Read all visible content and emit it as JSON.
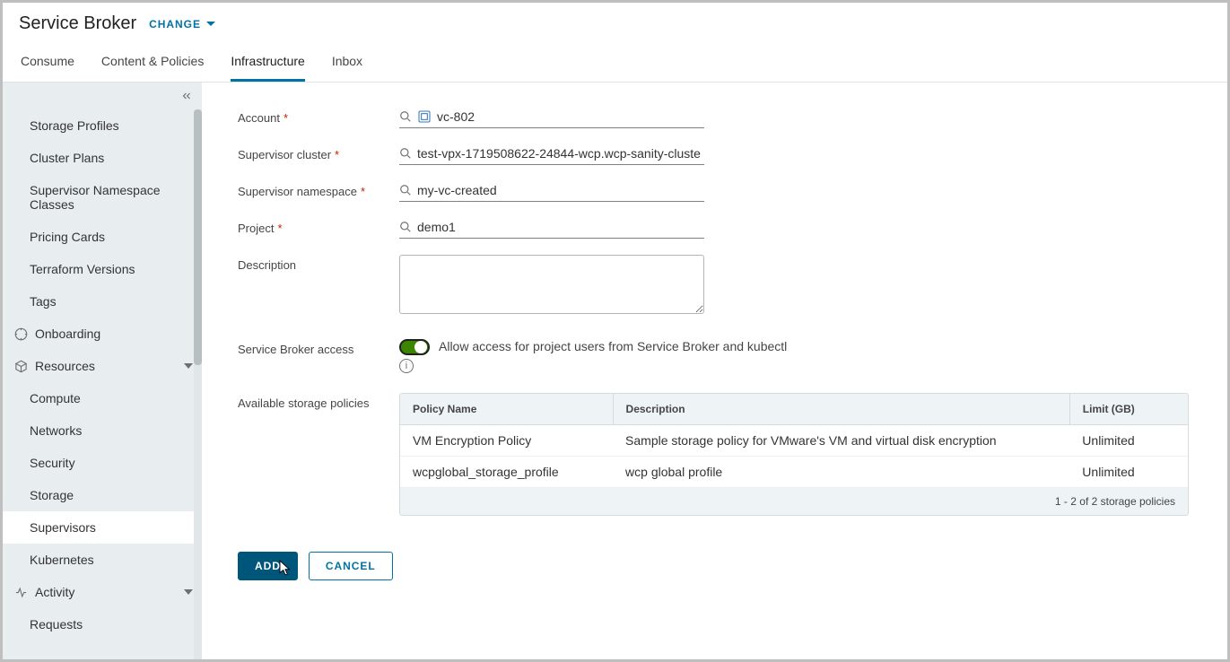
{
  "header": {
    "title": "Service Broker",
    "change_label": "CHANGE"
  },
  "tabs": {
    "consume": "Consume",
    "content_policies": "Content & Policies",
    "infrastructure": "Infrastructure",
    "inbox": "Inbox"
  },
  "sidebar": {
    "items_top": [
      "Storage Profiles",
      "Cluster Plans",
      "Supervisor Namespace Classes",
      "Pricing Cards",
      "Terraform Versions",
      "Tags"
    ],
    "onboarding": "Onboarding",
    "resources_label": "Resources",
    "resources_items": [
      "Compute",
      "Networks",
      "Security",
      "Storage",
      "Supervisors",
      "Kubernetes"
    ],
    "activity_label": "Activity",
    "activity_items": [
      "Requests"
    ]
  },
  "form": {
    "account_label": "Account",
    "account_value": "vc-802",
    "cluster_label": "Supervisor cluster",
    "cluster_value": "test-vpx-1719508622-24844-wcp.wcp-sanity-cluste",
    "namespace_label": "Supervisor namespace",
    "namespace_value": "my-vc-created",
    "project_label": "Project",
    "project_value": "demo1",
    "description_label": "Description",
    "access_label": "Service Broker access",
    "access_text": "Allow access for project users from Service Broker and kubectl",
    "table_label": "Available storage policies"
  },
  "table": {
    "col_name": "Policy Name",
    "col_desc": "Description",
    "col_limit": "Limit (GB)",
    "rows": [
      {
        "name": "VM Encryption Policy",
        "desc": "Sample storage policy for VMware's VM and virtual disk encryption",
        "limit": "Unlimited"
      },
      {
        "name": "wcpglobal_storage_profile",
        "desc": "wcp global profile",
        "limit": "Unlimited"
      }
    ],
    "footer": "1 - 2 of 2 storage policies"
  },
  "actions": {
    "add": "ADD",
    "cancel": "CANCEL"
  }
}
